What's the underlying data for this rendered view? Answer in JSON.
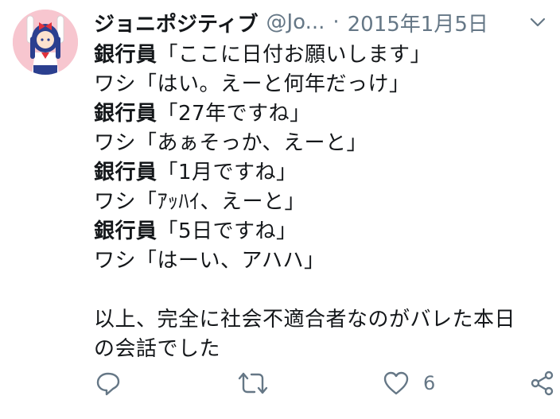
{
  "tweet": {
    "author_name": "ジョニポジティブ",
    "handle": "@Jo...",
    "separator": "·",
    "date": "2015年1月5日",
    "lines": [
      {
        "speaker": "銀行員",
        "text": "「ここに日付お願いします」"
      },
      {
        "speaker": "",
        "text": "ワシ「はい。えーと何年だっけ」"
      },
      {
        "speaker": "銀行員",
        "text": "「27年ですね」"
      },
      {
        "speaker": "",
        "text": "ワシ「あぁそっか、えーと」"
      },
      {
        "speaker": "銀行員",
        "text": "「1月ですね」"
      },
      {
        "speaker": "",
        "text": "ワシ「ｱｯﾊｲ、えーと」"
      },
      {
        "speaker": "銀行員",
        "text": "「5日ですね」"
      },
      {
        "speaker": "",
        "text": "ワシ「はーい、アハハ」"
      }
    ],
    "closing": [
      "以上、完全に社会不適合者なのがバレた本日",
      "の会話でした"
    ],
    "like_count": "6"
  },
  "icons": {
    "reply": "reply-icon",
    "retweet": "retweet-icon",
    "like": "heart-icon",
    "share": "share-icon",
    "menu": "chevron-down-icon"
  },
  "colors": {
    "text": "#14171a",
    "secondary": "#657786",
    "avatar_bg": "#f7c6cf"
  }
}
